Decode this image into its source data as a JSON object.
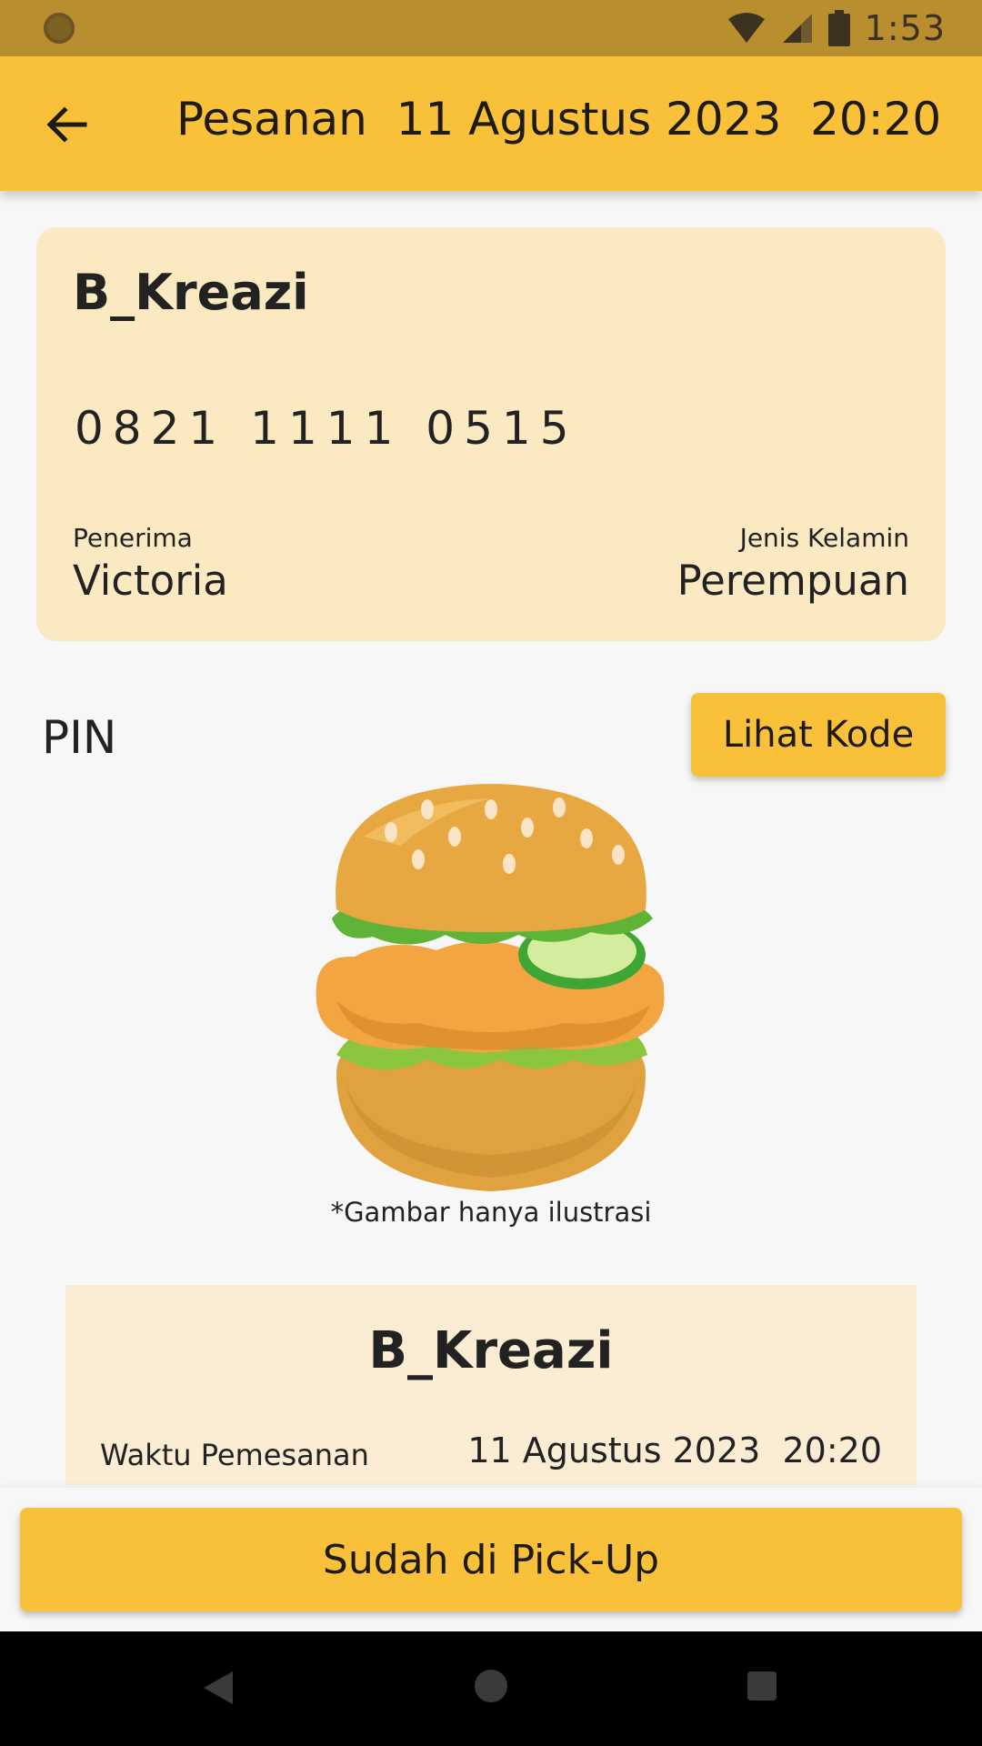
{
  "status_bar": {
    "time": "1:53",
    "icons": [
      "notification-icon",
      "wifi-icon",
      "signal-icon",
      "battery-icon"
    ]
  },
  "app_bar": {
    "title": "Pesanan  11 Agustus 2023  20:20",
    "back_icon": "arrow-left-icon"
  },
  "customer_card": {
    "name": "B_Kreazi",
    "phone": "0821 1111 0515",
    "recipient_label": "Penerima",
    "recipient_value": "Victoria",
    "gender_label": "Jenis Kelamin",
    "gender_value": "Perempuan"
  },
  "pin": {
    "label": "PIN",
    "button_label": "Lihat Kode"
  },
  "illustration": {
    "icon": "burger-illustration",
    "caption": "*Gambar hanya ilustrasi"
  },
  "summary": {
    "name": "B_Kreazi",
    "order_time_label": "Waktu Pemesanan",
    "order_time_value": "11 Agustus 2023  20:20"
  },
  "action": {
    "button_label": "Sudah di Pick-Up"
  },
  "colors": {
    "status_bar": "#B98E2E",
    "accent": "#F9C03A",
    "card_bg": "#FBE9C2",
    "summary_bg": "#FAEDD3"
  }
}
